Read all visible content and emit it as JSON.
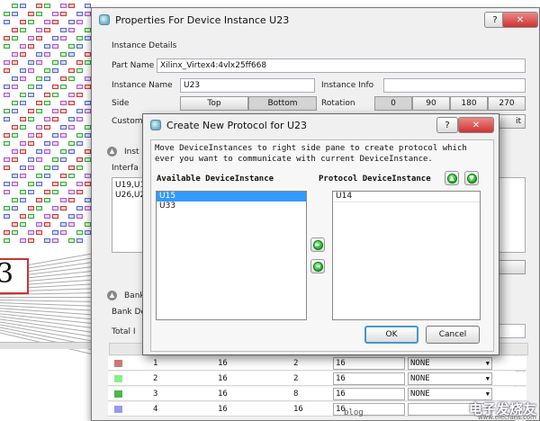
{
  "properties_dialog": {
    "title": "Properties For Device Instance U23",
    "help_label": "?",
    "close_label": "✕",
    "instance_details_label": "Instance Details",
    "part_name_label": "Part Name",
    "part_name_value": "Xilinx_Virtex4:4vlx25ff668",
    "instance_name_label": "Instance Name",
    "instance_name_value": "U23",
    "instance_info_label": "Instance Info",
    "instance_info_value": "",
    "side_label": "Side",
    "side_options": [
      "Top",
      "Bottom"
    ],
    "side_selected": "Bottom",
    "rotation_label": "Rotation",
    "rotation_options": [
      "0",
      "90",
      "180",
      "270"
    ],
    "custom_label": "Custom",
    "custom_button_partial": "it",
    "interfaces_section_partial": "Inst",
    "interfaces_label_partial": "Interfa",
    "interfaces_list_partial": [
      "U19,U1",
      "U26,U2"
    ],
    "bank_section_partial": "Bank",
    "bank_details_partial": "Bank De",
    "total_label_partial": "Total I",
    "bank_rows": [
      {
        "id": "1",
        "c2": "16",
        "c3": "2",
        "c4": "16",
        "c5": "NONE",
        "color": "#c87878"
      },
      {
        "id": "2",
        "c2": "16",
        "c3": "2",
        "c4": "16",
        "c5": "NONE",
        "color": "#88ee88"
      },
      {
        "id": "3",
        "c2": "16",
        "c3": "8",
        "c4": "16",
        "c5": "NONE",
        "color": "#4cb84c"
      },
      {
        "id": "4",
        "c2": "16",
        "c3": "16",
        "c4": "16",
        "c5": "",
        "color": "#9999ee"
      }
    ]
  },
  "create_dialog": {
    "title": "Create New Protocol for U23",
    "help_label": "?",
    "close_label": "✕",
    "instructions": "Move DeviceInstances to right side pane to create protocol which ever you want to communicate with current DeviceInstance.",
    "available_label": "Available DeviceInstance",
    "available_items": [
      "U15",
      "U33"
    ],
    "available_selected": "U15",
    "protocol_label": "Protocol DeviceInstance",
    "protocol_items": [
      "U14"
    ],
    "ok_label": "OK",
    "cancel_label": "Cancel"
  },
  "schematic": {
    "big_label": "3"
  },
  "watermark": {
    "logo_text": "电子发烧友",
    "url_partial": "blog",
    "url_small": "www.elecfans.com"
  },
  "colors": {
    "selection": "#3399ff",
    "close_red": "#c33",
    "green_arrow": "#2a2"
  }
}
